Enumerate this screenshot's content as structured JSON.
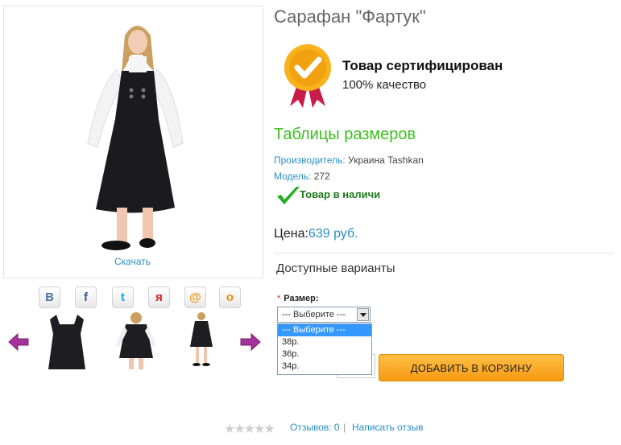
{
  "product": {
    "title": "Сарафан \"Фартук\"",
    "download_label": "Скачать",
    "certificate": {
      "title": "Товар сертифицирован",
      "subtitle": "100% качество"
    },
    "size_table_link": "Таблицы размеров",
    "manufacturer_label": "Производитель:",
    "manufacturer_value": "Украина Tashkan",
    "model_label": "Модель:",
    "model_value": "272",
    "stock_status": "Товар в наличи",
    "price_label": "Цена:",
    "price_value": "639 руб."
  },
  "options": {
    "section_title": "Доступные варианты",
    "size_required_mark": "*",
    "size_label": "Размер:",
    "selected": "--- Выберите ---",
    "list": [
      "--- Выберите ---",
      "38р.",
      "36р.",
      "34р."
    ]
  },
  "cart_button": "ДОБАВИТЬ В КОРЗИНУ",
  "share": [
    {
      "icon": "vk-icon",
      "glyph": "В",
      "color": "#4a76a8"
    },
    {
      "icon": "facebook-icon",
      "glyph": "f",
      "color": "#3b5998"
    },
    {
      "icon": "twitter-icon",
      "glyph": "t",
      "color": "#1da1f2"
    },
    {
      "icon": "yandex-icon",
      "glyph": "я",
      "color": "#e01e1e"
    },
    {
      "icon": "mailru-icon",
      "glyph": "@",
      "color": "#f29a0f"
    },
    {
      "icon": "odnoklassniki-icon",
      "glyph": "о",
      "color": "#f28a0b"
    }
  ],
  "reviews": {
    "stars": "★★★★★",
    "count_link": "Отзывов: 0",
    "separator": "|",
    "write_link": "Написать отзыв"
  },
  "colors": {
    "link": "#2a8fc6",
    "green": "#3cbf1e",
    "cart": "#f79a12",
    "arrow": "#9b2d8f"
  }
}
